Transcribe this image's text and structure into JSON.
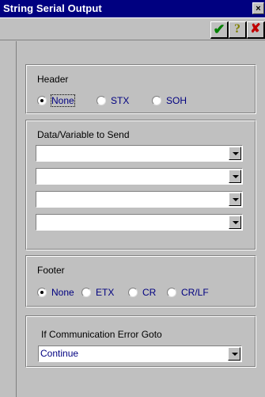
{
  "window": {
    "title": "String Serial Output",
    "close_glyph": "×"
  },
  "toolbar": {
    "ok_icon": "check-icon",
    "help_glyph": "?",
    "cancel_glyph": "✘",
    "ok_glyph": "✔"
  },
  "header": {
    "label": "Header",
    "options": [
      "None",
      "STX",
      "SOH"
    ],
    "selected": "None"
  },
  "data": {
    "label": "Data/Variable to Send",
    "fields": [
      "",
      "",
      "",
      ""
    ]
  },
  "footer": {
    "label": "Footer",
    "options": [
      "None",
      "ETX",
      "CR",
      "CR/LF"
    ],
    "selected": "None"
  },
  "error": {
    "label": "If Communication Error Goto",
    "value": "Continue"
  },
  "colors": {
    "title_bar": "#000080",
    "face": "#c0c0c0",
    "option_text": "#000080"
  }
}
